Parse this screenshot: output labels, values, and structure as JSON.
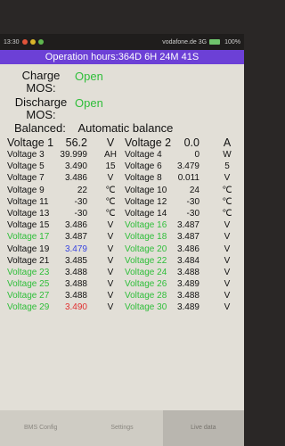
{
  "status": {
    "time": "13:30",
    "right": "vodafone.de 3G",
    "battery": "100%"
  },
  "operation": "Operation hours:364D 6H 24M 41S",
  "charge": {
    "label1": "Charge",
    "label2": "MOS:",
    "value": "Open"
  },
  "discharge": {
    "label1": "Discharge",
    "label2": "MOS:",
    "value": "Open"
  },
  "balanced": {
    "label": "Balanced:",
    "value": "Automatic balance"
  },
  "colors": {
    "green": "#2fbe3a",
    "blue": "#3a46e0",
    "red": "#e03030",
    "header": "#6c40d6"
  },
  "rows": [
    {
      "n1": "Voltage 1",
      "v1": "56.2",
      "u1": "V",
      "n2": "Voltage 2",
      "v2": "0.0",
      "u2": "A"
    },
    {
      "n1": "Voltage 3",
      "v1": "39.999",
      "u1": "AH",
      "n2": "Voltage 4",
      "v2": "0",
      "u2": "W"
    },
    {
      "n1": "Voltage 5",
      "v1": "3.490",
      "u1": "15",
      "n2": "Voltage 6",
      "v2": "3.479",
      "u2": "5"
    },
    {
      "n1": "Voltage 7",
      "v1": "3.486",
      "u1": "V",
      "n2": "Voltage 8",
      "v2": "0.011",
      "u2": "V"
    },
    {
      "n1": "Voltage 9",
      "v1": "22",
      "u1": "℃",
      "n2": "Voltage 10",
      "v2": "24",
      "u2": "℃"
    },
    {
      "n1": "Voltage 11",
      "v1": "-30",
      "u1": "℃",
      "n2": "Voltage 12",
      "v2": "-30",
      "u2": "℃"
    },
    {
      "n1": "Voltage 13",
      "v1": "-30",
      "u1": "℃",
      "n2": "Voltage 14",
      "v2": "-30",
      "u2": "℃"
    },
    {
      "n1": "Voltage 15",
      "v1": "3.486",
      "u1": "V",
      "n2": "Voltage 16",
      "v2": "3.487",
      "u2": "V"
    },
    {
      "n1": "Voltage 17",
      "v1": "3.487",
      "u1": "V",
      "n2": "Voltage 18",
      "v2": "3.487",
      "u2": "V"
    },
    {
      "n1": "Voltage 19",
      "v1": "3.479",
      "u1": "V",
      "n2": "Voltage 20",
      "v2": "3.486",
      "u2": "V"
    },
    {
      "n1": "Voltage 21",
      "v1": "3.485",
      "u1": "V",
      "n2": "Voltage 22",
      "v2": "3.484",
      "u2": "V"
    },
    {
      "n1": "Voltage 23",
      "v1": "3.488",
      "u1": "V",
      "n2": "Voltage 24",
      "v2": "3.488",
      "u2": "V"
    },
    {
      "n1": "Voltage 25",
      "v1": "3.488",
      "u1": "V",
      "n2": "Voltage 26",
      "v2": "3.489",
      "u2": "V"
    },
    {
      "n1": "Voltage 27",
      "v1": "3.488",
      "u1": "V",
      "n2": "Voltage 28",
      "v2": "3.488",
      "u2": "V"
    },
    {
      "n1": "Voltage 29",
      "v1": "3.490",
      "u1": "V",
      "n2": "Voltage 30",
      "v2": "3.489",
      "u2": "V"
    }
  ],
  "nav": [
    "BMS Config",
    "Settings",
    "Live data"
  ]
}
